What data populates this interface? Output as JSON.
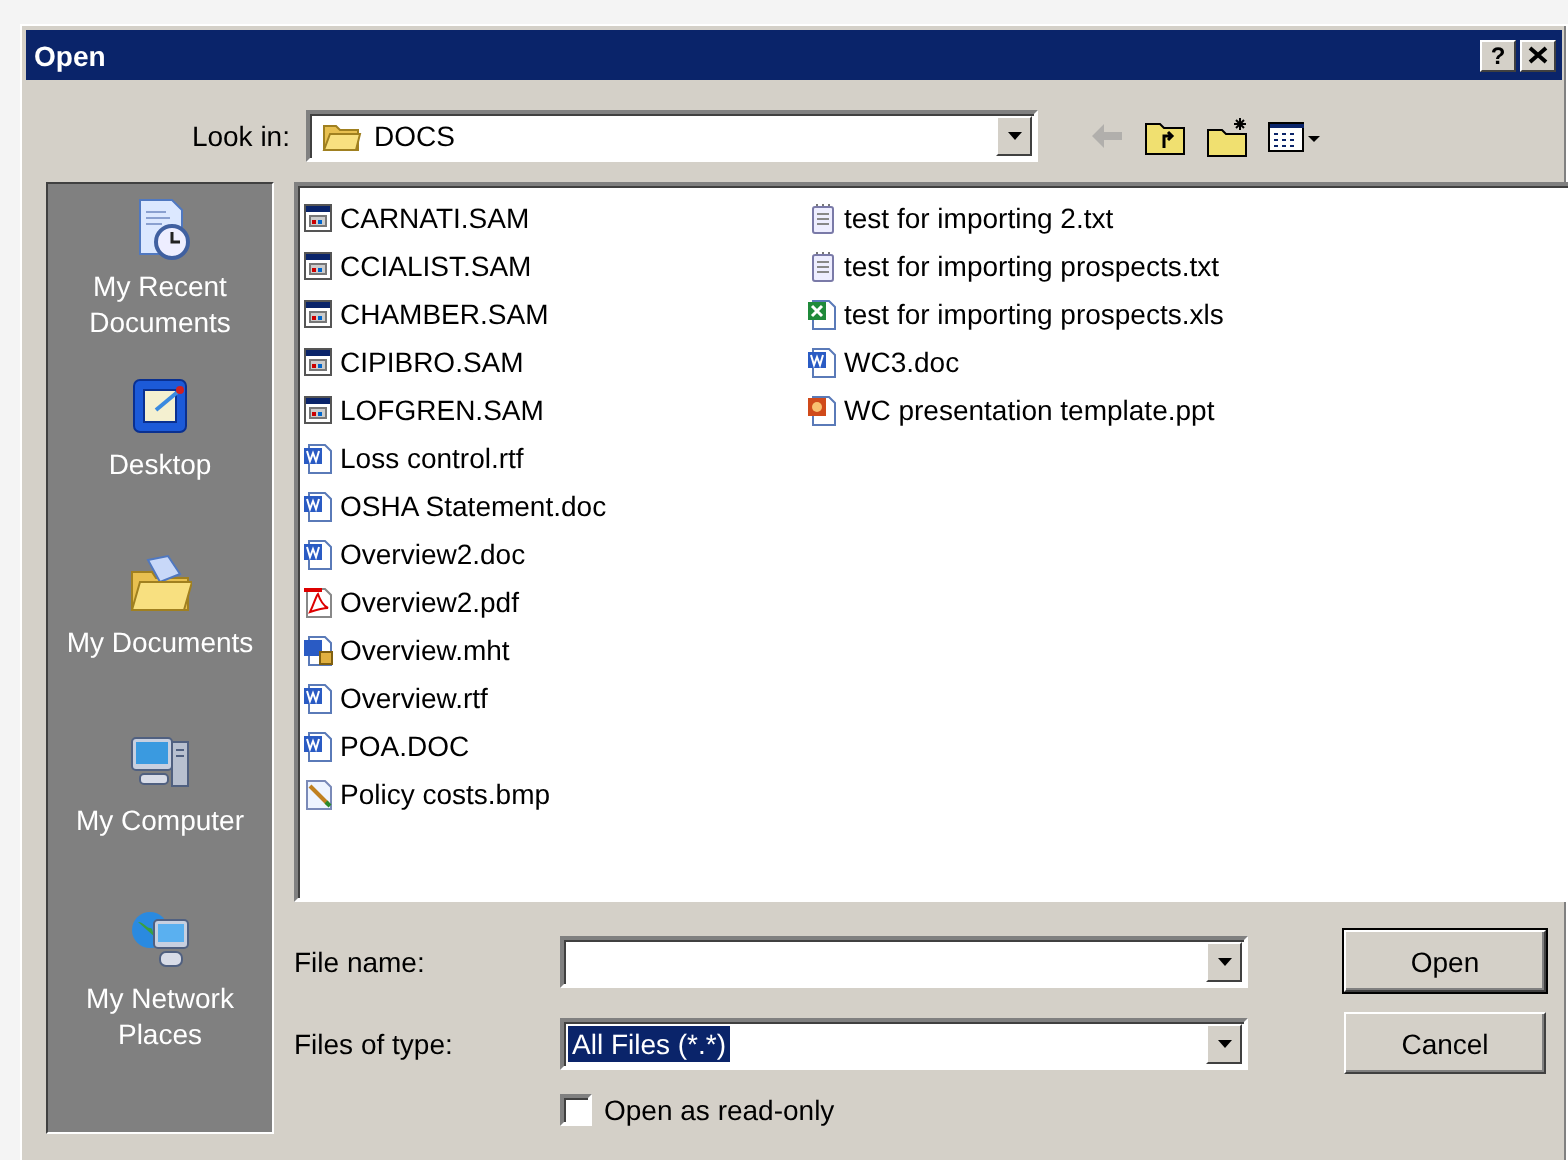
{
  "window": {
    "title": "Open",
    "title_buttons": [
      "?"
    ]
  },
  "look_in": {
    "label": "Look in:",
    "value": "DOCS"
  },
  "toolbar": [
    {
      "kind": "back",
      "disabled": true
    },
    {
      "kind": "up",
      "disabled": false
    },
    {
      "kind": "new-folder",
      "disabled": false
    },
    {
      "kind": "view-menu",
      "disabled": false
    }
  ],
  "places": [
    {
      "kind": "recent",
      "label": "My Recent Documents"
    },
    {
      "kind": "desktop",
      "label": "Desktop"
    },
    {
      "kind": "documents",
      "label": "My Documents"
    },
    {
      "kind": "computer",
      "label": "My Computer"
    },
    {
      "kind": "network",
      "label": "My Network Places"
    }
  ],
  "files": {
    "columns": [
      [
        {
          "kind": "sam",
          "name": "CARNATI.SAM"
        },
        {
          "kind": "sam",
          "name": "CCIALIST.SAM"
        },
        {
          "kind": "sam",
          "name": "CHAMBER.SAM"
        },
        {
          "kind": "sam",
          "name": "CIPIBRO.SAM"
        },
        {
          "kind": "sam",
          "name": "LOFGREN.SAM"
        },
        {
          "kind": "word",
          "name": "Loss control.rtf"
        },
        {
          "kind": "word",
          "name": "OSHA Statement.doc"
        },
        {
          "kind": "word",
          "name": "Overview2.doc"
        },
        {
          "kind": "pdf",
          "name": "Overview2.pdf"
        },
        {
          "kind": "mht",
          "name": "Overview.mht"
        },
        {
          "kind": "word",
          "name": "Overview.rtf"
        },
        {
          "kind": "word",
          "name": "POA.DOC"
        },
        {
          "kind": "bmp",
          "name": "Policy costs.bmp"
        }
      ],
      [
        {
          "kind": "txt",
          "name": "test for importing 2.txt"
        },
        {
          "kind": "txt",
          "name": "test for importing prospects.txt"
        },
        {
          "kind": "xls",
          "name": "test for importing prospects.xls"
        },
        {
          "kind": "word",
          "name": "WC3.doc"
        },
        {
          "kind": "ppt",
          "name": "WC presentation template.ppt"
        }
      ]
    ]
  },
  "file_name": {
    "label": "File name:"
  },
  "files_of_type": {
    "label": "Files of type:",
    "value": "All Files (*.*)",
    "highlighted": true
  },
  "read_only": {
    "label": "Open as read-only",
    "checked": false
  },
  "buttons": [
    {
      "label": "Open",
      "default": true
    },
    {
      "label": "Cancel",
      "default": false
    }
  ]
}
